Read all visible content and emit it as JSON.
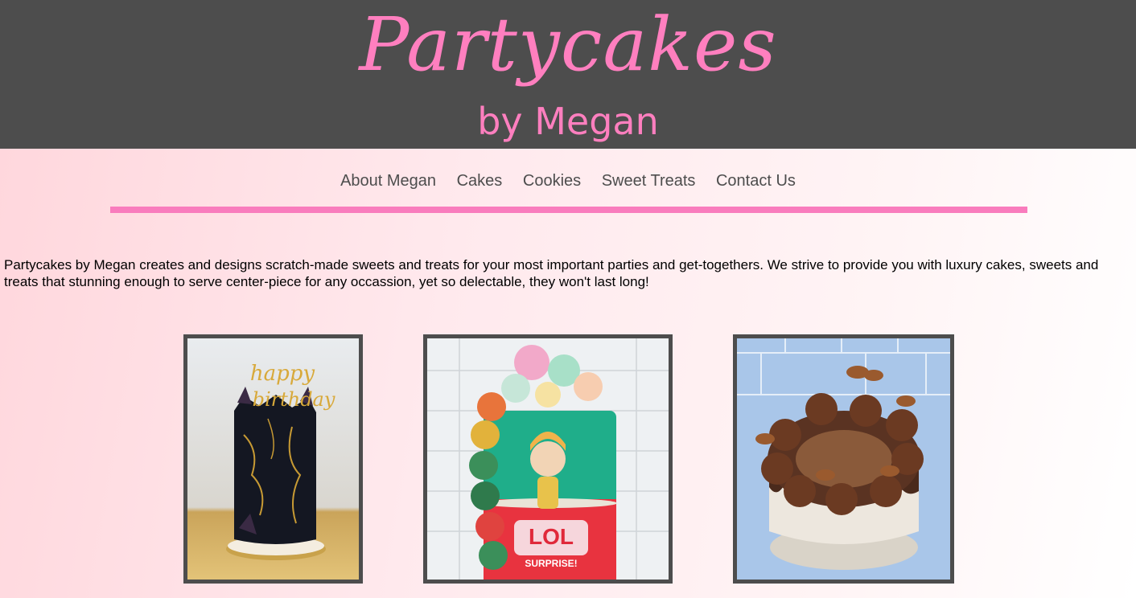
{
  "header": {
    "brand_script": "Partycakes",
    "brand_sub": "by Megan",
    "background_color": "#4d4d4d",
    "accent_color": "#ff7fbf"
  },
  "nav": {
    "items": [
      {
        "label": "About Megan"
      },
      {
        "label": "Cakes"
      },
      {
        "label": "Cookies"
      },
      {
        "label": "Sweet Treats"
      },
      {
        "label": "Contact Us"
      }
    ],
    "rule_color": "#f97cbd"
  },
  "intro": {
    "text": "Partycakes by Megan creates and designs scratch-made sweets and treats for your most important parties and get-togethers. We strive to provide you with luxury cakes, sweets and treats that stunning enough to serve center-piece for any occassion, yet so delectable, they won't last long!"
  },
  "gallery": {
    "photos": [
      {
        "subject": "black-and-gold-birthday-cake-with-happy-birthday-topper",
        "lettering": "happy birthday"
      },
      {
        "subject": "lol-surprise-tiered-cake-with-unicorn-doll",
        "lettering": "LOL SURPRISE!"
      },
      {
        "subject": "chocolate-drip-cake-with-peanut-butter-cups"
      }
    ]
  }
}
